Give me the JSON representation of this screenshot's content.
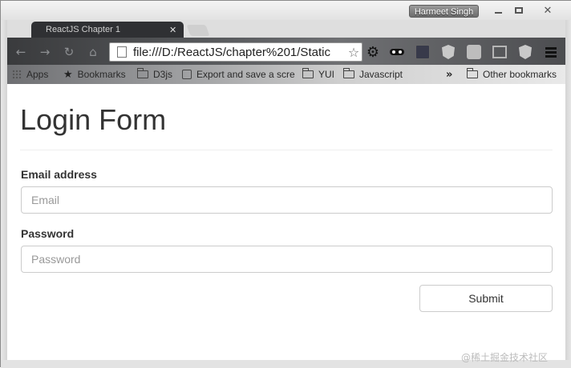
{
  "window": {
    "user_name": "Harmeet Singh",
    "controls": {
      "minimize_icon": "minimize-icon",
      "maximize_icon": "maximize-icon",
      "close_glyph": "✕"
    }
  },
  "tabs": [
    {
      "label": "ReactJS Chapter 1",
      "close_glyph": "✕"
    }
  ],
  "toolbar": {
    "back_glyph": "←",
    "forward_glyph": "→",
    "reload_glyph": "↻",
    "home_glyph": "⌂",
    "url": "file:///D:/ReactJS/chapter%201/Static",
    "bookmark_star": "☆",
    "gear_glyph": "⚙"
  },
  "bookmarks": {
    "items": [
      {
        "label": "Apps",
        "icon": "apps-grid-icon"
      },
      {
        "label": "Bookmarks",
        "icon": "star-icon"
      },
      {
        "label": "D3js",
        "icon": "folder-icon"
      },
      {
        "label": "Export and save a scre",
        "icon": "page-icon"
      },
      {
        "label": "YUI",
        "icon": "folder-icon"
      },
      {
        "label": "Javascript",
        "icon": "folder-icon"
      }
    ],
    "more_glyph": "»",
    "other_label": "Other bookmarks"
  },
  "page": {
    "title": "Login Form",
    "email": {
      "label": "Email address",
      "placeholder": "Email",
      "value": ""
    },
    "password": {
      "label": "Password",
      "placeholder": "Password",
      "value": ""
    },
    "submit_label": "Submit"
  },
  "watermark": "@稀土掘金技术社区"
}
